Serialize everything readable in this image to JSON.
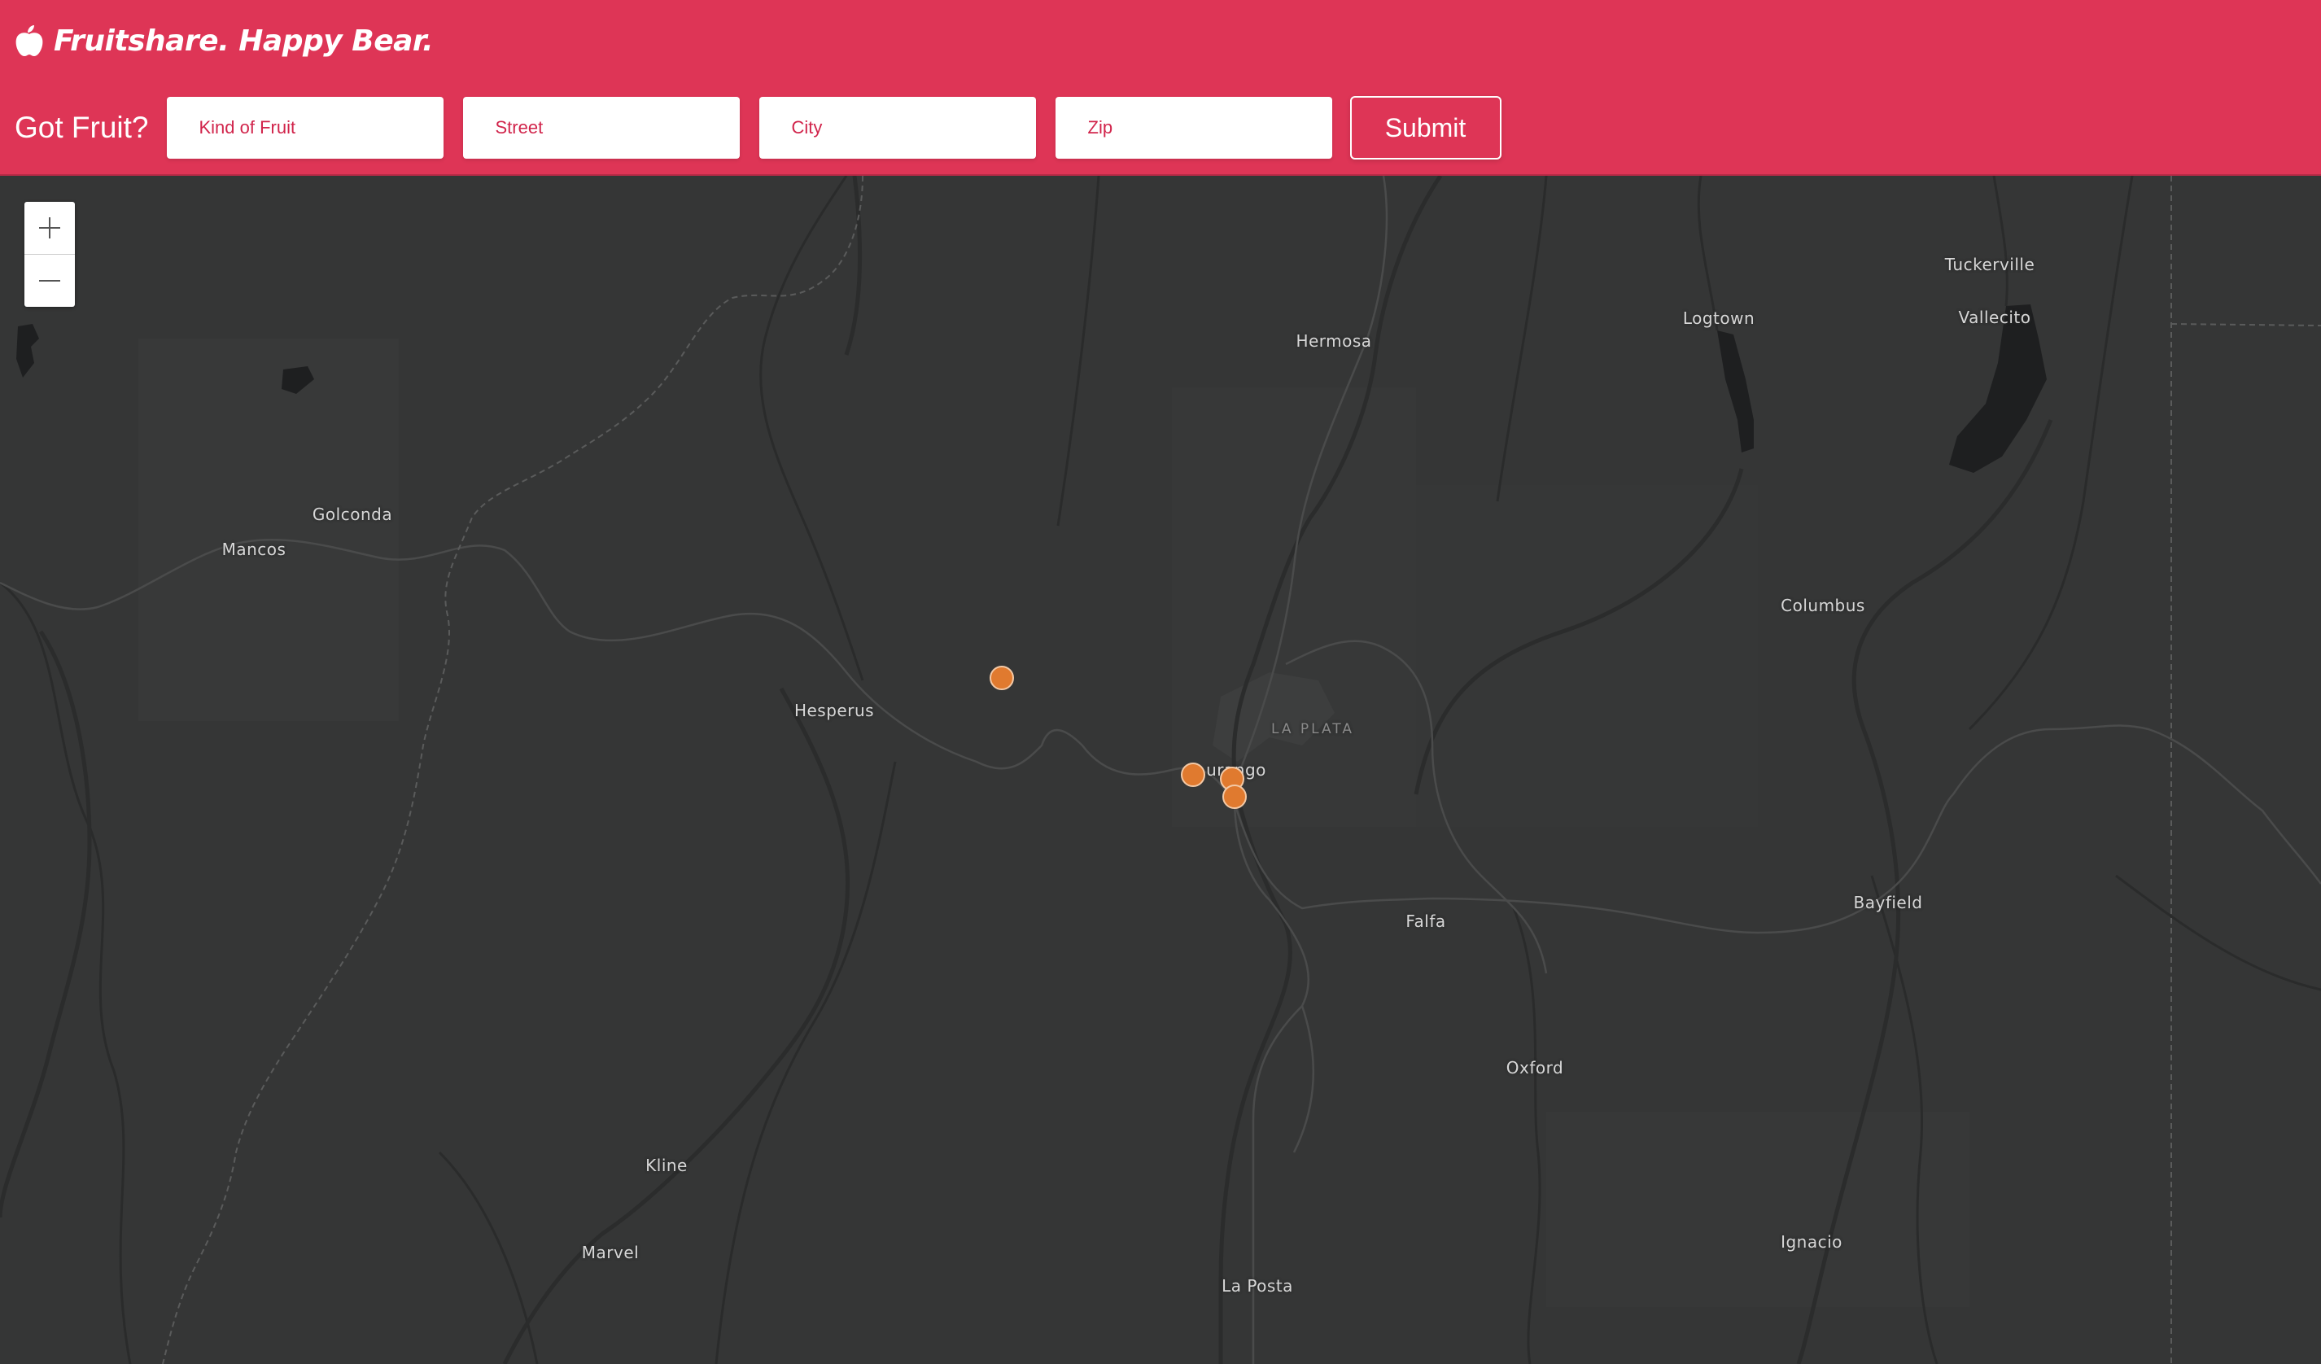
{
  "header": {
    "brand": "Fruitshare. Happy Bear.",
    "brand_icon": "apple-icon",
    "accent_color": "#de3556",
    "prompt": "Got Fruit?",
    "fields": {
      "fruit_placeholder": "Kind of Fruit",
      "street_placeholder": "Street",
      "city_placeholder": "City",
      "zip_placeholder": "Zip"
    },
    "submit_label": "Submit"
  },
  "map": {
    "zoom_in_icon": "plus-icon",
    "zoom_out_icon": "minus-icon",
    "marker_color": "#e07a2f",
    "places": {
      "tuckerville": "Tuckerville",
      "vallecito": "Vallecito",
      "logtown": "Logtown",
      "hermosa": "Hermosa",
      "golconda": "Golconda",
      "mancos": "Mancos",
      "columbus": "Columbus",
      "hesperus": "Hesperus",
      "la_plata": "LA PLATA",
      "durango": "urango",
      "bayfield": "Bayfield",
      "falfa": "Falfa",
      "oxford": "Oxford",
      "kline": "Kline",
      "marvel": "Marvel",
      "ignacio": "Ignacio",
      "la_posta": "La Posta"
    }
  }
}
